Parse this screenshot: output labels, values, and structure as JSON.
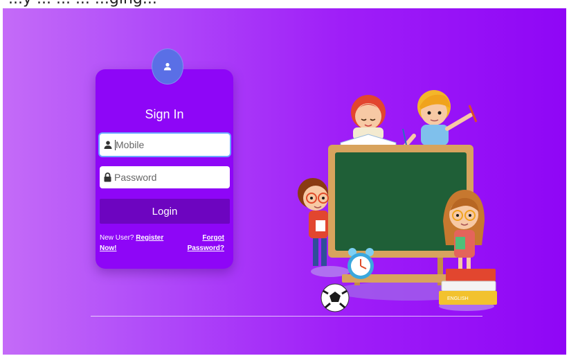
{
  "page": {
    "top_text": "...y ... ... ... ...ging..."
  },
  "login": {
    "title": "Sign In",
    "mobile_placeholder": "Mobile",
    "password_placeholder": "Password",
    "login_label": "Login",
    "new_user_text": "New User?",
    "register_line1": "Register",
    "register_line2": "Now!",
    "forgot_line1": "Forgot",
    "forgot_line2": "Password?"
  },
  "illustration": {
    "book_label": "ENGLISH"
  },
  "colors": {
    "card": "#8e06f7",
    "button": "#6d05c0",
    "avatar": "#5a6fe6",
    "chalkboard": "#1f5f37"
  }
}
